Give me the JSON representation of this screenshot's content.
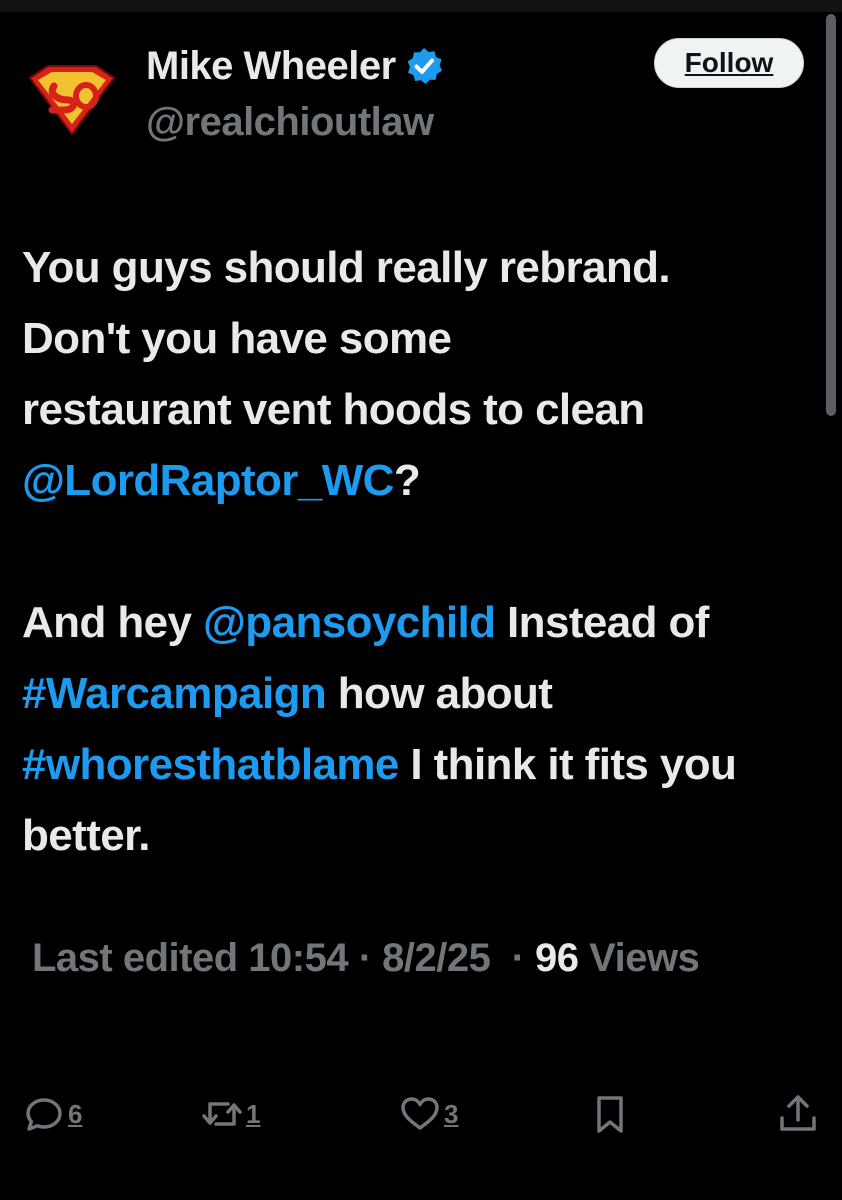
{
  "author": {
    "display_name": "Mike Wheeler",
    "handle": "@realchioutlaw",
    "verified_icon": "verified-badge-icon",
    "avatar_icon": "superman-shield-logo"
  },
  "follow_button": {
    "label": "Follow"
  },
  "tweet": {
    "paragraph1": {
      "line1": "You guys should really rebrand.",
      "line2": "Don't you have some",
      "line3": "restaurant vent hoods to clean",
      "mention": "@LordRaptor_WC",
      "mention_suffix": "?"
    },
    "paragraph2": {
      "prefix": "And hey ",
      "mention": "@pansoychild",
      "after_mention": " Instead of ",
      "hashtag1": "#Warcampaign",
      "after_hashtag1": " how about ",
      "hashtag2": "#whoresthatblame",
      "suffix": " I think it fits you better."
    }
  },
  "meta": {
    "edited_label": "Last edited",
    "time": "10:54",
    "date": "8/2/25",
    "views_count": "96",
    "views_label": "Views"
  },
  "actions": {
    "reply_count": "6",
    "repost_count": "1",
    "like_count": "3"
  },
  "colors": {
    "background": "#000000",
    "text": "#e7e9ea",
    "secondary": "#71767b",
    "link": "#1d9bf0",
    "button_bg": "#eff3f4"
  }
}
